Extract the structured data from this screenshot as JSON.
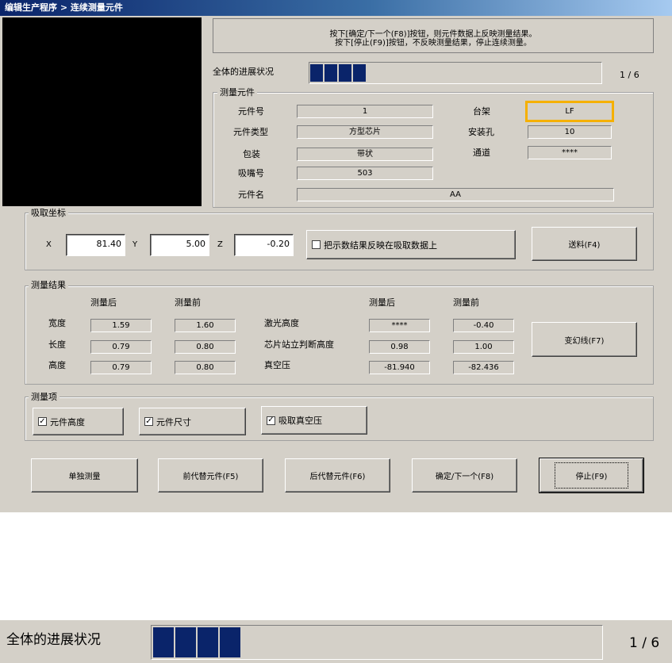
{
  "window": {
    "title": "编辑生产程序 > 连续测量元件"
  },
  "instructions": {
    "line1": "按下[确定/下一个(F8)]按钮，则元件数据上反映测量结果。",
    "line2": "按下[停止(F9)]按钮，不反映测量结果，停止连续测量。"
  },
  "progress": {
    "label": "全体的进展状况",
    "current": 1,
    "total": 6,
    "counter": "1 / 6",
    "blocks": 4
  },
  "component": {
    "group_title": "测量元件",
    "part_no_label": "元件号",
    "part_no": "1",
    "type_label": "元件类型",
    "type": "方型芯片",
    "package_label": "包装",
    "package": "带状",
    "nozzle_label": "吸嘴号",
    "nozzle": "503",
    "name_label": "元件名",
    "name": "AA",
    "stage_label": "台架",
    "stage": "LF",
    "mount_hole_label": "安装孔",
    "mount_hole": "10",
    "channel_label": "通道",
    "channel": "****"
  },
  "pickup": {
    "group_title": "吸取坐标",
    "x_label": "X",
    "x": "81.40",
    "y_label": "Y",
    "y": "5.00",
    "z_label": "Z",
    "z": "-0.20",
    "reflect_label": "把示数结果反映在吸取数据上",
    "feed_button": "送料(F4)"
  },
  "results": {
    "group_title": "测量结果",
    "after_header": "测量后",
    "before_header": "测量前",
    "width_label": "宽度",
    "width_after": "1.59",
    "width_before": "1.60",
    "length_label": "长度",
    "length_after": "0.79",
    "length_before": "0.80",
    "height_label": "高度",
    "height_after": "0.79",
    "height_before": "0.80",
    "laser_label": "激光高度",
    "laser_after": "****",
    "laser_before": "-0.40",
    "standing_label": "芯片站立判断高度",
    "standing_after": "0.98",
    "standing_before": "1.00",
    "vacuum_label": "真空压",
    "vacuum_after": "-81.940",
    "vacuum_before": "-82.436",
    "transform_button": "变幻线(F7)"
  },
  "measure_items": {
    "group_title": "测量项",
    "height_label": "元件高度",
    "height_checked": true,
    "size_label": "元件尺寸",
    "size_checked": true,
    "vacuum_label": "吸取真空压",
    "vacuum_checked": true
  },
  "buttons": {
    "single": "单独测量",
    "prev": "前代替元件(F5)",
    "next": "后代替元件(F6)",
    "ok_next": "确定/下一个(F8)",
    "stop": "停止(F9)"
  },
  "colors": {
    "highlight": "#f5b000",
    "progress_fill": "#0a246a",
    "title_bar": "#0a246a"
  }
}
